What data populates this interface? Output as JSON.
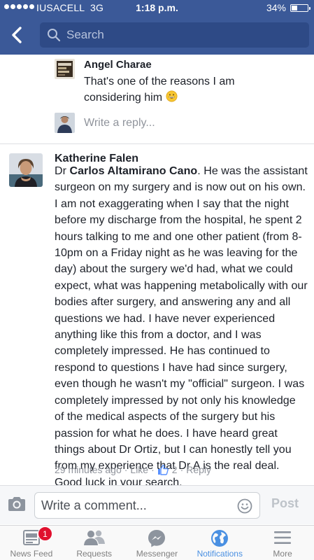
{
  "status_bar": {
    "carrier": "IUSACELL",
    "network": "3G",
    "time": "1:18 p.m.",
    "battery": "34%",
    "battery_level": 0.34
  },
  "header": {
    "search_placeholder": "Search",
    "back_icon": "chevron-left-icon",
    "search_icon": "search-icon",
    "color": "#3b5998"
  },
  "reply": {
    "author": "Angel Charae",
    "text": "That's one of the reasons I am considering him",
    "emoji": "grinning-face"
  },
  "write_reply": {
    "placeholder": "Write a reply..."
  },
  "comment": {
    "author": "Katherine Falen",
    "text_prefix": "Dr ",
    "text_bold": "Carlos Altamirano Cano",
    "text_rest": ". He was the assistant surgeon on my surgery and is now out on his own. I am not exaggerating when I say that the night before my discharge from the hospital, he spent 2 hours talking to me and one other patient (from 8-10pm on a Friday night as he was leaving for the day) about the surgery we'd had, what we could expect, what was happening metabolically with our bodies after surgery, and answering any and all questions we had. I have never experienced anything like this from a doctor, and I was completely impressed. He has continued to respond to questions I have had since surgery, even though he wasn't my \"official\" surgeon. I was completely impressed by not only his knowledge of the medical aspects of the surgery but his passion for what he does. I have heard great things about Dr Ortiz, but I can honestly tell you from my experience that Dr A is the real deal. Good luck in your search.",
    "time": "29 minutes ago",
    "like_label": "Like",
    "like_count": "2",
    "reply_label": "Reply"
  },
  "composer": {
    "placeholder": "Write a comment...",
    "post_label": "Post"
  },
  "tabbar": {
    "tabs": [
      {
        "label": "News Feed",
        "icon": "news-feed-icon",
        "badge": "1"
      },
      {
        "label": "Requests",
        "icon": "friends-icon"
      },
      {
        "label": "Messenger",
        "icon": "messenger-icon"
      },
      {
        "label": "Notifications",
        "icon": "globe-icon",
        "active": true
      },
      {
        "label": "More",
        "icon": "menu-icon"
      }
    ],
    "active_color": "#4a90e2"
  }
}
